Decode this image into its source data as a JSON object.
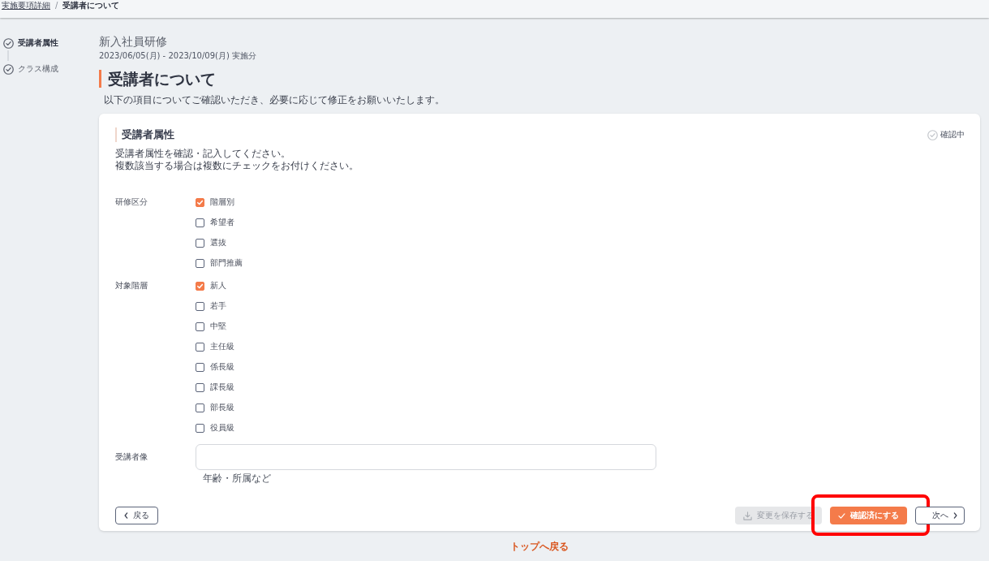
{
  "breadcrumb": {
    "items": [
      {
        "label": "実施要項詳細",
        "link": true
      },
      {
        "label": "受講者について",
        "link": false
      }
    ],
    "separator": "/"
  },
  "steps": [
    {
      "label": "受講者属性",
      "selected": true
    },
    {
      "label": "クラス構成",
      "selected": false
    }
  ],
  "course": {
    "title": "新入社員研修",
    "period": "2023/06/05(月) - 2023/10/09(月) 実施分"
  },
  "heading": "受講者について",
  "description": "以下の項目についてご確認いただき、必要に応じて修正をお願いいたします。",
  "card": {
    "title": "受講者属性",
    "status": {
      "label": "確認中",
      "confirmed": false
    },
    "instructions": [
      "受講者属性を確認・記入してください。",
      "複数該当する場合は複数にチェックをお付けください。"
    ],
    "fields": [
      {
        "kind": "checkboxes",
        "label": "研修区分",
        "options": [
          {
            "label": "階層別",
            "checked": true
          },
          {
            "label": "希望者",
            "checked": false
          },
          {
            "label": "選抜",
            "checked": false
          },
          {
            "label": "部門推薦",
            "checked": false
          }
        ]
      },
      {
        "kind": "checkboxes",
        "label": "対象階層",
        "options": [
          {
            "label": "新人",
            "checked": true
          },
          {
            "label": "若手",
            "checked": false
          },
          {
            "label": "中堅",
            "checked": false
          },
          {
            "label": "主任級",
            "checked": false
          },
          {
            "label": "係長級",
            "checked": false
          },
          {
            "label": "課長級",
            "checked": false
          },
          {
            "label": "部長級",
            "checked": false
          },
          {
            "label": "役員級",
            "checked": false
          }
        ]
      },
      {
        "kind": "textarea",
        "label": "受講者像",
        "hint": "年齢・所属など"
      }
    ],
    "footer": {
      "left": [
        {
          "kind": "back",
          "label": "戻る",
          "disabled": false,
          "highlighted": false
        }
      ],
      "right": [
        {
          "kind": "save",
          "label": "変更を保存する",
          "disabled": true,
          "highlighted": false
        },
        {
          "kind": "confirm",
          "label": "確認済にする",
          "disabled": false,
          "highlighted": true
        },
        {
          "kind": "next",
          "label": "次へ",
          "disabled": false,
          "highlighted": false
        }
      ]
    }
  },
  "back_to_top": "トップへ戻る"
}
